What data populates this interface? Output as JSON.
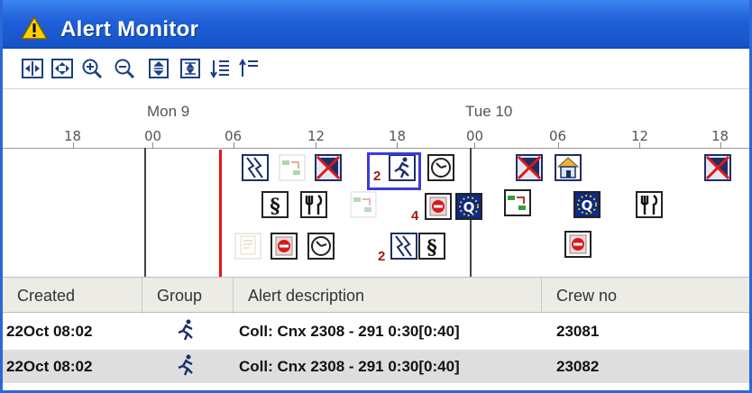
{
  "window": {
    "title": "Alert Monitor"
  },
  "toolbar": {
    "buttons": [
      {
        "name": "fit-width-icon"
      },
      {
        "name": "fit-all-icon"
      },
      {
        "name": "zoom-in-icon"
      },
      {
        "name": "zoom-out-icon"
      },
      {
        "name": "expand-rows-icon"
      },
      {
        "name": "collapse-rows-icon"
      },
      {
        "name": "sort-descending-icon"
      },
      {
        "name": "sort-ascending-icon"
      }
    ]
  },
  "timeline": {
    "days": [
      "Mon 9",
      "Tue 10"
    ],
    "hours": [
      "18",
      "00",
      "06",
      "12",
      "18",
      "00",
      "06",
      "12",
      "18"
    ],
    "bubble_counts": [
      "2",
      "4",
      "2"
    ],
    "alert_icons": [
      "split-icon",
      "transfer-icon",
      "cancelled-flight-icon",
      "runner-icon",
      "clock-icon",
      "section-icon",
      "meal-icon",
      "stop-icon",
      "eu-q-icon",
      "home-icon",
      "document-icon"
    ]
  },
  "grid": {
    "columns": [
      "Created",
      "Group",
      "Alert description",
      "Crew no"
    ],
    "rows": [
      {
        "created": "22Oct 08:02",
        "group_icon": "runner-icon",
        "description": "Coll: Cnx 2308 - 291   0:30[0:40]",
        "crew": "23081"
      },
      {
        "created": "22Oct 08:02",
        "group_icon": "runner-icon",
        "description": "Coll: Cnx 2308 - 291   0:30[0:40]",
        "crew": "23082"
      }
    ]
  },
  "colors": {
    "titlebar": "#1f5fd8",
    "now_line": "#e01818",
    "selected_row": "#dedede",
    "count_text": "#a01818"
  }
}
